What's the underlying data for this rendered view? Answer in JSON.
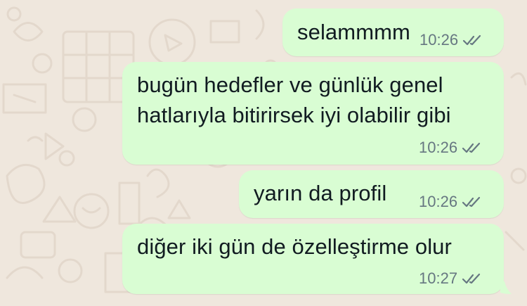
{
  "chat": {
    "messages": [
      {
        "text": "selammmm",
        "time": "10:26",
        "status_icon": "double-check-icon"
      },
      {
        "lines": [
          "bugün hedefler ve günlük genel",
          "hatlarıyla bitirirsek iyi olabilir gibi"
        ],
        "time": "10:26",
        "status_icon": "double-check-icon"
      },
      {
        "text": "yarın da profil",
        "time": "10:26",
        "status_icon": "double-check-icon"
      },
      {
        "text": "diğer iki gün de özelleştirme olur",
        "time": "10:27",
        "status_icon": "double-check-icon"
      }
    ],
    "colors": {
      "wallpaper": "#efe7dd",
      "outgoing_bubble": "#d9fdd3",
      "message_text": "#111b21",
      "meta_text": "#667781"
    }
  }
}
